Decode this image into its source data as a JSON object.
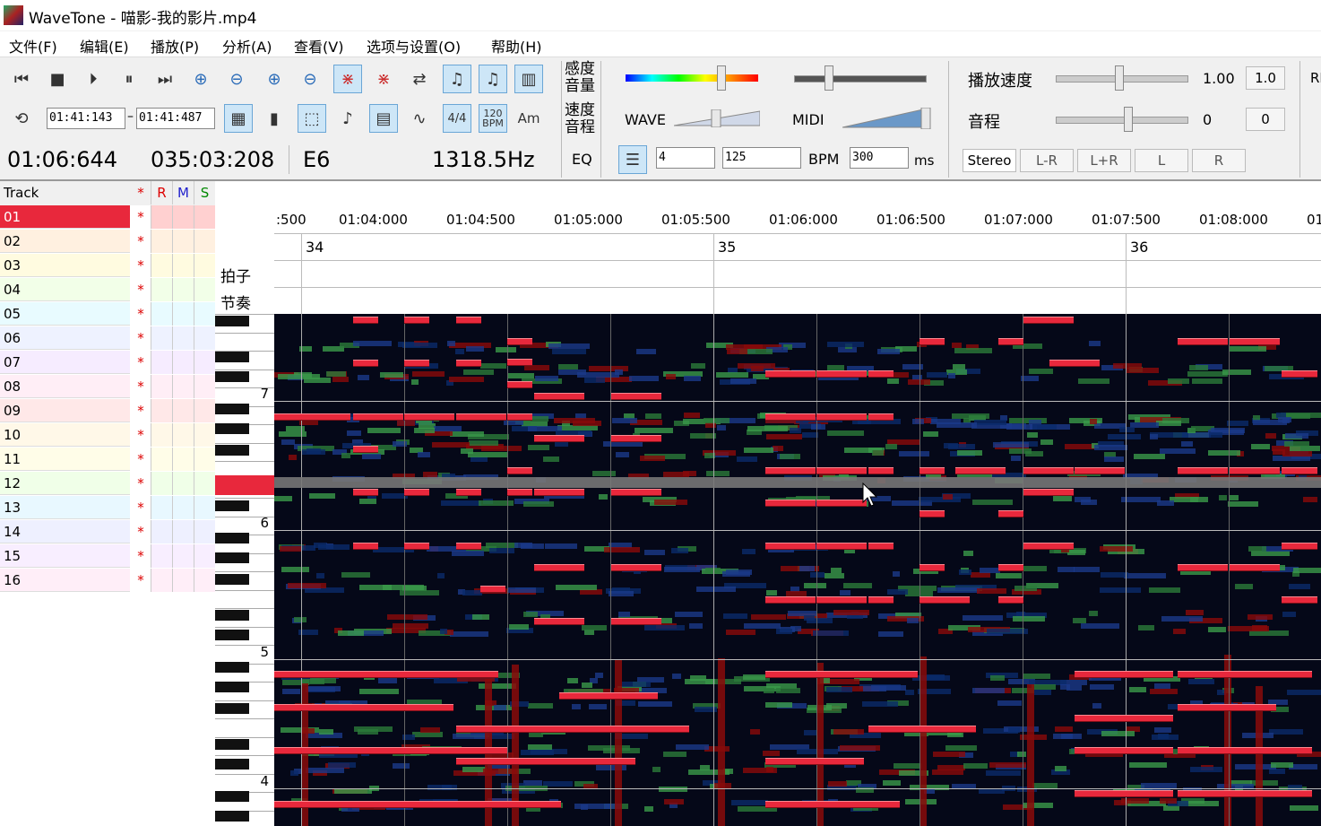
{
  "window": {
    "title": "WaveTone - 喵影-我的影片.mp4"
  },
  "menu": [
    "文件(F)",
    "编辑(E)",
    "播放(P)",
    "分析(A)",
    "查看(V)",
    "选项与设置(O)",
    "帮助(H)"
  ],
  "toolbar": {
    "range_start": "01:41:143",
    "range_dash": "–",
    "range_end": "01:41:487",
    "current_time": "01:06:644",
    "bar_beat": "035:03:208",
    "note": "E6",
    "frequency": "1318.5Hz",
    "meter_label": "4/4",
    "bpm_icon_top": "120",
    "bpm_icon_bottom": "BPM",
    "chord_label": "Am",
    "sensitivity_label_1": "感度",
    "sensitivity_label_2": "音量",
    "speed_label_1": "速度",
    "speed_label_2": "音程",
    "eq_label": "EQ",
    "wave_label": "WAVE",
    "midi_label": "MIDI",
    "spin1_value": "4",
    "spin2_value": "125",
    "bpm_label": "BPM",
    "ms_value": "300",
    "ms_label": "ms",
    "play_speed_label": "播放速度",
    "play_speed_value": "1.00",
    "play_speed_reset": "1.0",
    "pitch_label": "音程",
    "pitch_value": "0",
    "pitch_reset": "0",
    "stereo_buttons": [
      "Stereo",
      "L-R",
      "L+R",
      "L",
      "R"
    ],
    "cut_label": "RE"
  },
  "tracks": {
    "header": {
      "name": "Track",
      "star": "*",
      "r": "R",
      "m": "M",
      "s": "S"
    },
    "rows": [
      "01",
      "02",
      "03",
      "04",
      "05",
      "06",
      "07",
      "08",
      "09",
      "10",
      "11",
      "12",
      "13",
      "14",
      "15",
      "16"
    ],
    "star": "*",
    "colors": [
      "#ffd0d0",
      "#fff0e0",
      "#fffbe0",
      "#f2ffe8",
      "#e8fbff",
      "#eef2ff",
      "#f6ecff",
      "#ffeef6",
      "#ffe8e8",
      "#fff8e8",
      "#fffde8",
      "#f0ffe8",
      "#e8f8ff",
      "#eef0ff",
      "#f8eeff",
      "#ffeef8"
    ]
  },
  "timeline": {
    "ticks": [
      ":500",
      "01:04:000",
      "01:04:500",
      "01:05:000",
      "01:05:500",
      "01:06:000",
      "01:06:500",
      "01:07:000",
      "01:07:500",
      "01:08:000",
      "01"
    ],
    "bars": [
      "34",
      "35",
      "36"
    ],
    "beat_label": "拍子",
    "rhythm_label": "节奏"
  },
  "keyboard": {
    "octaves": [
      "7",
      "6",
      "5",
      "4"
    ]
  }
}
